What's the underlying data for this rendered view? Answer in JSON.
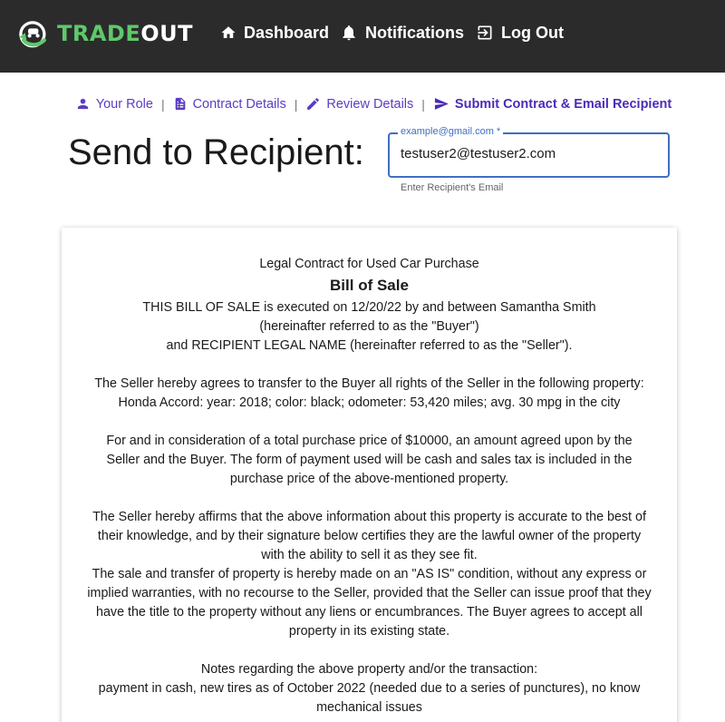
{
  "app": {
    "logo_left": "TRADE",
    "logo_right": "OUT"
  },
  "nav": {
    "dashboard": "Dashboard",
    "notifications": "Notifications",
    "logout": "Log Out"
  },
  "stepper": {
    "steps": [
      {
        "label": "Your Role",
        "icon": "person-icon"
      },
      {
        "label": "Contract Details",
        "icon": "document-icon"
      },
      {
        "label": "Review Details",
        "icon": "pencil-icon"
      },
      {
        "label": "Submit Contract & Email Recipient",
        "icon": "send-icon"
      }
    ],
    "separator": "|"
  },
  "send": {
    "heading": "Send to Recipient:",
    "floating_label": "example@gmail.com *",
    "value": "testuser2@testuser2.com",
    "helper": "Enter Recipient's Email"
  },
  "contract": {
    "heading": "Legal Contract for Used Car Purchase",
    "title": "Bill of Sale",
    "p1_line1": "THIS BILL OF SALE is executed on 12/20/22 by and between Samantha Smith (hereinafter referred to as the \"Buyer\")",
    "p1_line2": "and RECIPIENT LEGAL NAME (hereinafter referred to as the \"Seller\").",
    "p2_line1": "The Seller hereby agrees to transfer to the Buyer all rights of the Seller in the following property:",
    "p2_line2": "Honda Accord: year: 2018; color: black; odometer: 53,420 miles; avg. 30 mpg in the city",
    "p3": "For and in consideration of a total purchase price of $10000, an amount agreed upon by the Seller and the Buyer. The form of payment used will be cash and sales tax is included in the purchase price of the above-mentioned property.",
    "p4": "The Seller hereby affirms that the above information about this property is accurate to the best of their knowledge, and by their signature below certifies they are the lawful owner of the property with the ability to sell it as they see fit.",
    "p5": "The sale and transfer of property is hereby made on an \"AS IS\" condition, without any express or implied warranties, with no recourse to the Seller, provided that the Seller can issue proof that they have the title to the property without any liens or encumbrances. The Buyer agrees to accept all property in its existing state.",
    "p6_line1": "Notes regarding the above property and/or the transaction:",
    "p6_line2": "payment in cash, new tires as of October 2022 (needed due to a series of punctures), no know mechanical issues"
  },
  "colors": {
    "navbar": "#2b2b2b",
    "accent_green": "#5fc86a",
    "stepper_purple": "#5b3cc4",
    "input_blue": "#3f6fc0"
  }
}
